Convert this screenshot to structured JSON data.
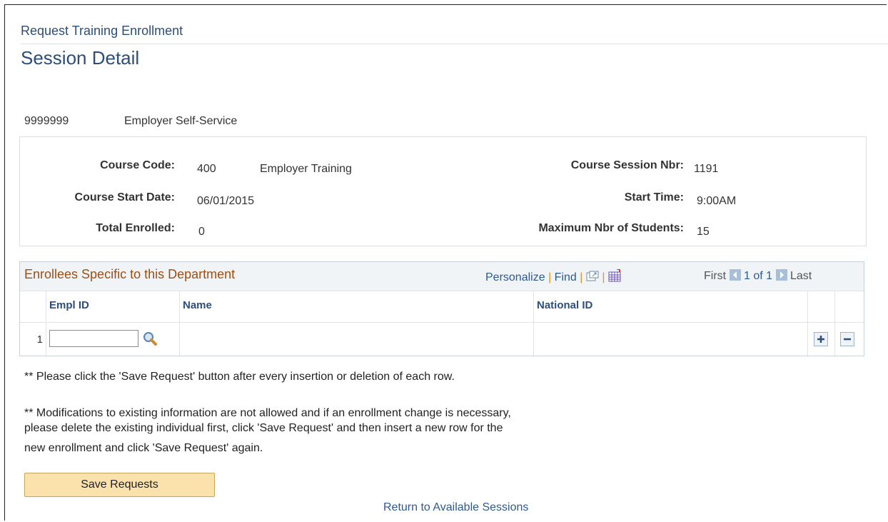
{
  "header": {
    "breadcrumb": "Request Training Enrollment",
    "title": "Session Detail"
  },
  "employer": {
    "id": "9999999",
    "name": "Employer Self-Service"
  },
  "course": {
    "code_label": "Course Code:",
    "code_value": "400",
    "code_name": "Employer Training",
    "start_date_label": "Course Start Date:",
    "start_date_value": "06/01/2015",
    "total_enrolled_label": "Total Enrolled:",
    "total_enrolled_value": "0",
    "session_nbr_label": "Course Session Nbr:",
    "session_nbr_value": "1191",
    "start_time_label": "Start Time:",
    "start_time_value": "9:00AM",
    "max_students_label": "Maximum Nbr of Students:",
    "max_students_value": "15"
  },
  "grid": {
    "title": "Enrollees Specific to this Department",
    "personalize": "Personalize",
    "find": "Find",
    "sep": "|",
    "first": "First",
    "page_info": "1 of 1",
    "last": "Last",
    "columns": [
      "Empl ID",
      "Name",
      "National ID"
    ],
    "rows": [
      {
        "num": "1",
        "empl_id": "",
        "name": "",
        "national_id": ""
      }
    ]
  },
  "notes": {
    "note1": "** Please click the 'Save Request' button after every insertion or deletion of each row.",
    "note2_line1": "** Modifications to existing information are not allowed and if an enrollment change is necessary,",
    "note2_line2": "please delete the existing individual first, click 'Save Request' and then insert a new row for the",
    "note2_line3": "new enrollment and click 'Save Request' again."
  },
  "actions": {
    "save_label": "Save Requests",
    "return_label": "Return to Available Sessions"
  },
  "colors": {
    "title_blue": "#2c4e78",
    "grid_title_brown": "#9a4f15",
    "button_bg": "#fbe2ac",
    "link_blue": "#2c5a8f"
  }
}
